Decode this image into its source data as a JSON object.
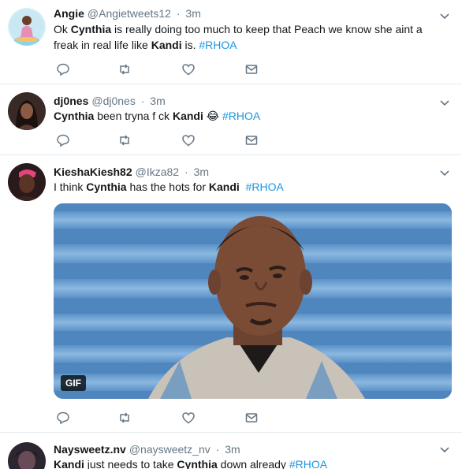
{
  "tweets": [
    {
      "name": "Angie",
      "handle": "@Angietweets12",
      "time": "3m",
      "text_parts": [
        "Ok ",
        "Cynthia",
        " is really doing too much to keep that Peach we know she aint a freak in real life like ",
        "Kandi",
        " is. ",
        "#RHOA"
      ]
    },
    {
      "name": "dj0nes",
      "handle": "@dj0nes",
      "time": "3m",
      "text_parts": [
        "Cynthia",
        " been tryna f  ck ",
        "Kandi",
        " 😂 ",
        "#RHOA"
      ]
    },
    {
      "name": "KieshaKiesh82",
      "handle": "@Ikza82",
      "time": "3m",
      "text_parts": [
        "I think ",
        "Cynthia",
        " has the hots for ",
        "Kandi",
        "  ",
        "#RHOA"
      ],
      "media_badge": "GIF"
    },
    {
      "name": "Naysweetz.nv",
      "handle": "@naysweetz_nv",
      "time": "3m",
      "text_parts": [
        "Kandi",
        " just needs to take ",
        "Cynthia",
        " down already ",
        "#RHOA"
      ]
    }
  ],
  "separator": "·",
  "icons": {
    "reply": "reply-icon",
    "retweet": "retweet-icon",
    "like": "heart-icon",
    "dm": "envelope-icon",
    "more": "chevron-down-icon"
  },
  "colors": {
    "link": "#1b95e0",
    "secondary": "#657786",
    "icon": "#657786",
    "divider": "#e6ecf0"
  }
}
